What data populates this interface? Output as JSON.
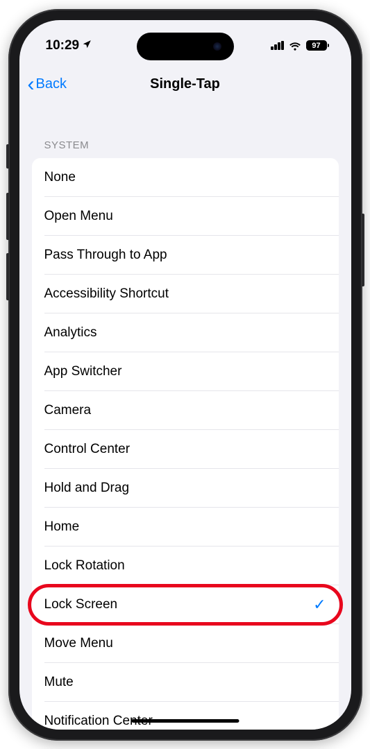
{
  "status": {
    "time": "10:29",
    "battery_level": "97"
  },
  "nav": {
    "back_label": "Back",
    "title": "Single-Tap"
  },
  "section": {
    "header": "SYSTEM",
    "items": [
      {
        "label": "None",
        "selected": false
      },
      {
        "label": "Open Menu",
        "selected": false
      },
      {
        "label": "Pass Through to App",
        "selected": false
      },
      {
        "label": "Accessibility Shortcut",
        "selected": false
      },
      {
        "label": "Analytics",
        "selected": false
      },
      {
        "label": "App Switcher",
        "selected": false
      },
      {
        "label": "Camera",
        "selected": false
      },
      {
        "label": "Control Center",
        "selected": false
      },
      {
        "label": "Hold and Drag",
        "selected": false
      },
      {
        "label": "Home",
        "selected": false
      },
      {
        "label": "Lock Rotation",
        "selected": false
      },
      {
        "label": "Lock Screen",
        "selected": true,
        "highlighted": true
      },
      {
        "label": "Move Menu",
        "selected": false
      },
      {
        "label": "Mute",
        "selected": false
      },
      {
        "label": "Notification Center",
        "selected": false
      }
    ]
  }
}
